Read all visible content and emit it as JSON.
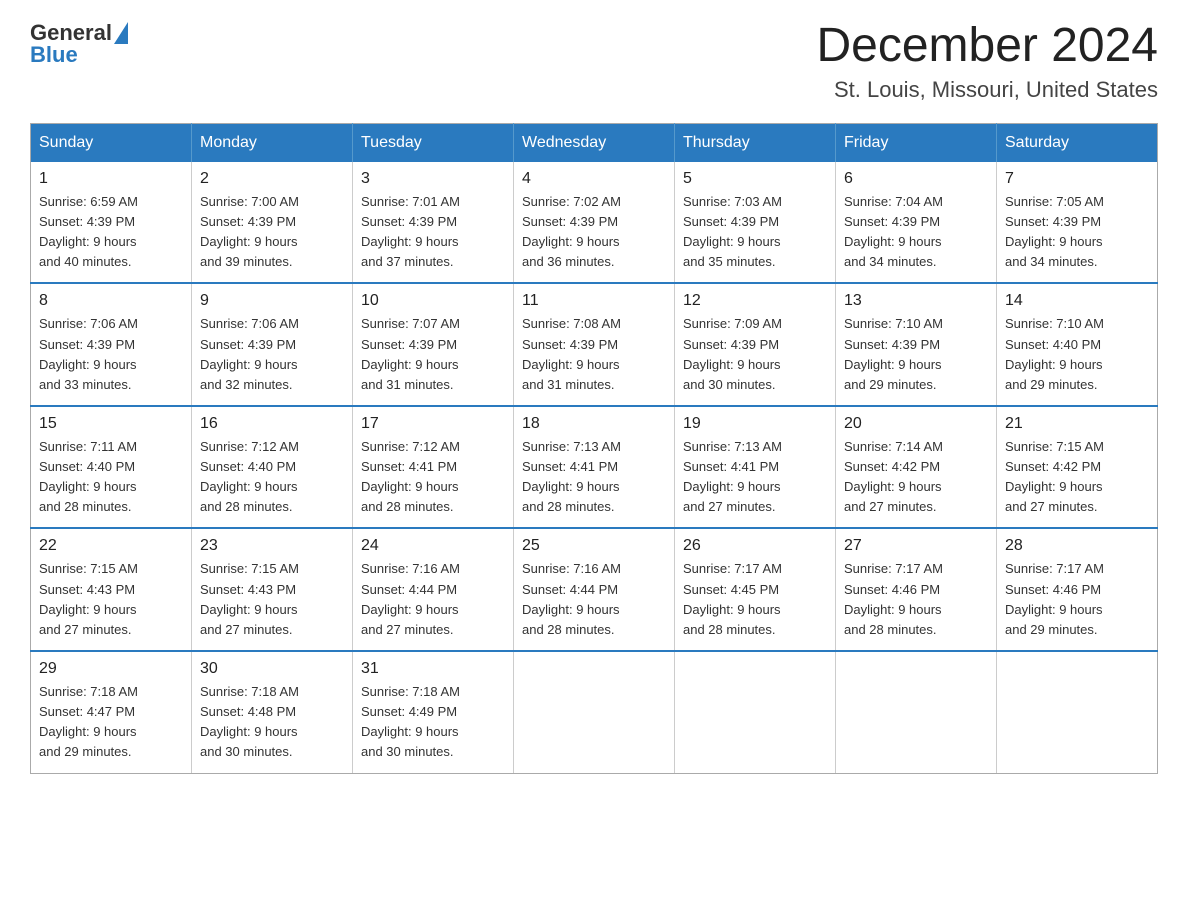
{
  "header": {
    "logo_general": "General",
    "logo_blue": "Blue",
    "month_year": "December 2024",
    "location": "St. Louis, Missouri, United States"
  },
  "weekdays": [
    "Sunday",
    "Monday",
    "Tuesday",
    "Wednesday",
    "Thursday",
    "Friday",
    "Saturday"
  ],
  "weeks": [
    [
      {
        "day": "1",
        "sunrise": "6:59 AM",
        "sunset": "4:39 PM",
        "daylight": "9 hours and 40 minutes."
      },
      {
        "day": "2",
        "sunrise": "7:00 AM",
        "sunset": "4:39 PM",
        "daylight": "9 hours and 39 minutes."
      },
      {
        "day": "3",
        "sunrise": "7:01 AM",
        "sunset": "4:39 PM",
        "daylight": "9 hours and 37 minutes."
      },
      {
        "day": "4",
        "sunrise": "7:02 AM",
        "sunset": "4:39 PM",
        "daylight": "9 hours and 36 minutes."
      },
      {
        "day": "5",
        "sunrise": "7:03 AM",
        "sunset": "4:39 PM",
        "daylight": "9 hours and 35 minutes."
      },
      {
        "day": "6",
        "sunrise": "7:04 AM",
        "sunset": "4:39 PM",
        "daylight": "9 hours and 34 minutes."
      },
      {
        "day": "7",
        "sunrise": "7:05 AM",
        "sunset": "4:39 PM",
        "daylight": "9 hours and 34 minutes."
      }
    ],
    [
      {
        "day": "8",
        "sunrise": "7:06 AM",
        "sunset": "4:39 PM",
        "daylight": "9 hours and 33 minutes."
      },
      {
        "day": "9",
        "sunrise": "7:06 AM",
        "sunset": "4:39 PM",
        "daylight": "9 hours and 32 minutes."
      },
      {
        "day": "10",
        "sunrise": "7:07 AM",
        "sunset": "4:39 PM",
        "daylight": "9 hours and 31 minutes."
      },
      {
        "day": "11",
        "sunrise": "7:08 AM",
        "sunset": "4:39 PM",
        "daylight": "9 hours and 31 minutes."
      },
      {
        "day": "12",
        "sunrise": "7:09 AM",
        "sunset": "4:39 PM",
        "daylight": "9 hours and 30 minutes."
      },
      {
        "day": "13",
        "sunrise": "7:10 AM",
        "sunset": "4:39 PM",
        "daylight": "9 hours and 29 minutes."
      },
      {
        "day": "14",
        "sunrise": "7:10 AM",
        "sunset": "4:40 PM",
        "daylight": "9 hours and 29 minutes."
      }
    ],
    [
      {
        "day": "15",
        "sunrise": "7:11 AM",
        "sunset": "4:40 PM",
        "daylight": "9 hours and 28 minutes."
      },
      {
        "day": "16",
        "sunrise": "7:12 AM",
        "sunset": "4:40 PM",
        "daylight": "9 hours and 28 minutes."
      },
      {
        "day": "17",
        "sunrise": "7:12 AM",
        "sunset": "4:41 PM",
        "daylight": "9 hours and 28 minutes."
      },
      {
        "day": "18",
        "sunrise": "7:13 AM",
        "sunset": "4:41 PM",
        "daylight": "9 hours and 28 minutes."
      },
      {
        "day": "19",
        "sunrise": "7:13 AM",
        "sunset": "4:41 PM",
        "daylight": "9 hours and 27 minutes."
      },
      {
        "day": "20",
        "sunrise": "7:14 AM",
        "sunset": "4:42 PM",
        "daylight": "9 hours and 27 minutes."
      },
      {
        "day": "21",
        "sunrise": "7:15 AM",
        "sunset": "4:42 PM",
        "daylight": "9 hours and 27 minutes."
      }
    ],
    [
      {
        "day": "22",
        "sunrise": "7:15 AM",
        "sunset": "4:43 PM",
        "daylight": "9 hours and 27 minutes."
      },
      {
        "day": "23",
        "sunrise": "7:15 AM",
        "sunset": "4:43 PM",
        "daylight": "9 hours and 27 minutes."
      },
      {
        "day": "24",
        "sunrise": "7:16 AM",
        "sunset": "4:44 PM",
        "daylight": "9 hours and 27 minutes."
      },
      {
        "day": "25",
        "sunrise": "7:16 AM",
        "sunset": "4:44 PM",
        "daylight": "9 hours and 28 minutes."
      },
      {
        "day": "26",
        "sunrise": "7:17 AM",
        "sunset": "4:45 PM",
        "daylight": "9 hours and 28 minutes."
      },
      {
        "day": "27",
        "sunrise": "7:17 AM",
        "sunset": "4:46 PM",
        "daylight": "9 hours and 28 minutes."
      },
      {
        "day": "28",
        "sunrise": "7:17 AM",
        "sunset": "4:46 PM",
        "daylight": "9 hours and 29 minutes."
      }
    ],
    [
      {
        "day": "29",
        "sunrise": "7:18 AM",
        "sunset": "4:47 PM",
        "daylight": "9 hours and 29 minutes."
      },
      {
        "day": "30",
        "sunrise": "7:18 AM",
        "sunset": "4:48 PM",
        "daylight": "9 hours and 30 minutes."
      },
      {
        "day": "31",
        "sunrise": "7:18 AM",
        "sunset": "4:49 PM",
        "daylight": "9 hours and 30 minutes."
      },
      null,
      null,
      null,
      null
    ]
  ],
  "labels": {
    "sunrise": "Sunrise:",
    "sunset": "Sunset:",
    "daylight": "Daylight:"
  }
}
